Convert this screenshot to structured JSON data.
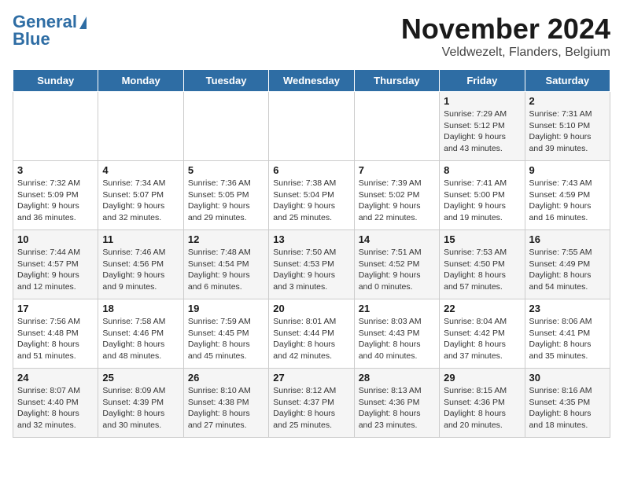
{
  "logo": {
    "line1": "General",
    "line2": "Blue"
  },
  "title": "November 2024",
  "location": "Veldwezelt, Flanders, Belgium",
  "days_of_week": [
    "Sunday",
    "Monday",
    "Tuesday",
    "Wednesday",
    "Thursday",
    "Friday",
    "Saturday"
  ],
  "weeks": [
    [
      {
        "day": "",
        "detail": ""
      },
      {
        "day": "",
        "detail": ""
      },
      {
        "day": "",
        "detail": ""
      },
      {
        "day": "",
        "detail": ""
      },
      {
        "day": "",
        "detail": ""
      },
      {
        "day": "1",
        "detail": "Sunrise: 7:29 AM\nSunset: 5:12 PM\nDaylight: 9 hours and 43 minutes."
      },
      {
        "day": "2",
        "detail": "Sunrise: 7:31 AM\nSunset: 5:10 PM\nDaylight: 9 hours and 39 minutes."
      }
    ],
    [
      {
        "day": "3",
        "detail": "Sunrise: 7:32 AM\nSunset: 5:09 PM\nDaylight: 9 hours and 36 minutes."
      },
      {
        "day": "4",
        "detail": "Sunrise: 7:34 AM\nSunset: 5:07 PM\nDaylight: 9 hours and 32 minutes."
      },
      {
        "day": "5",
        "detail": "Sunrise: 7:36 AM\nSunset: 5:05 PM\nDaylight: 9 hours and 29 minutes."
      },
      {
        "day": "6",
        "detail": "Sunrise: 7:38 AM\nSunset: 5:04 PM\nDaylight: 9 hours and 25 minutes."
      },
      {
        "day": "7",
        "detail": "Sunrise: 7:39 AM\nSunset: 5:02 PM\nDaylight: 9 hours and 22 minutes."
      },
      {
        "day": "8",
        "detail": "Sunrise: 7:41 AM\nSunset: 5:00 PM\nDaylight: 9 hours and 19 minutes."
      },
      {
        "day": "9",
        "detail": "Sunrise: 7:43 AM\nSunset: 4:59 PM\nDaylight: 9 hours and 16 minutes."
      }
    ],
    [
      {
        "day": "10",
        "detail": "Sunrise: 7:44 AM\nSunset: 4:57 PM\nDaylight: 9 hours and 12 minutes."
      },
      {
        "day": "11",
        "detail": "Sunrise: 7:46 AM\nSunset: 4:56 PM\nDaylight: 9 hours and 9 minutes."
      },
      {
        "day": "12",
        "detail": "Sunrise: 7:48 AM\nSunset: 4:54 PM\nDaylight: 9 hours and 6 minutes."
      },
      {
        "day": "13",
        "detail": "Sunrise: 7:50 AM\nSunset: 4:53 PM\nDaylight: 9 hours and 3 minutes."
      },
      {
        "day": "14",
        "detail": "Sunrise: 7:51 AM\nSunset: 4:52 PM\nDaylight: 9 hours and 0 minutes."
      },
      {
        "day": "15",
        "detail": "Sunrise: 7:53 AM\nSunset: 4:50 PM\nDaylight: 8 hours and 57 minutes."
      },
      {
        "day": "16",
        "detail": "Sunrise: 7:55 AM\nSunset: 4:49 PM\nDaylight: 8 hours and 54 minutes."
      }
    ],
    [
      {
        "day": "17",
        "detail": "Sunrise: 7:56 AM\nSunset: 4:48 PM\nDaylight: 8 hours and 51 minutes."
      },
      {
        "day": "18",
        "detail": "Sunrise: 7:58 AM\nSunset: 4:46 PM\nDaylight: 8 hours and 48 minutes."
      },
      {
        "day": "19",
        "detail": "Sunrise: 7:59 AM\nSunset: 4:45 PM\nDaylight: 8 hours and 45 minutes."
      },
      {
        "day": "20",
        "detail": "Sunrise: 8:01 AM\nSunset: 4:44 PM\nDaylight: 8 hours and 42 minutes."
      },
      {
        "day": "21",
        "detail": "Sunrise: 8:03 AM\nSunset: 4:43 PM\nDaylight: 8 hours and 40 minutes."
      },
      {
        "day": "22",
        "detail": "Sunrise: 8:04 AM\nSunset: 4:42 PM\nDaylight: 8 hours and 37 minutes."
      },
      {
        "day": "23",
        "detail": "Sunrise: 8:06 AM\nSunset: 4:41 PM\nDaylight: 8 hours and 35 minutes."
      }
    ],
    [
      {
        "day": "24",
        "detail": "Sunrise: 8:07 AM\nSunset: 4:40 PM\nDaylight: 8 hours and 32 minutes."
      },
      {
        "day": "25",
        "detail": "Sunrise: 8:09 AM\nSunset: 4:39 PM\nDaylight: 8 hours and 30 minutes."
      },
      {
        "day": "26",
        "detail": "Sunrise: 8:10 AM\nSunset: 4:38 PM\nDaylight: 8 hours and 27 minutes."
      },
      {
        "day": "27",
        "detail": "Sunrise: 8:12 AM\nSunset: 4:37 PM\nDaylight: 8 hours and 25 minutes."
      },
      {
        "day": "28",
        "detail": "Sunrise: 8:13 AM\nSunset: 4:36 PM\nDaylight: 8 hours and 23 minutes."
      },
      {
        "day": "29",
        "detail": "Sunrise: 8:15 AM\nSunset: 4:36 PM\nDaylight: 8 hours and 20 minutes."
      },
      {
        "day": "30",
        "detail": "Sunrise: 8:16 AM\nSunset: 4:35 PM\nDaylight: 8 hours and 18 minutes."
      }
    ]
  ]
}
